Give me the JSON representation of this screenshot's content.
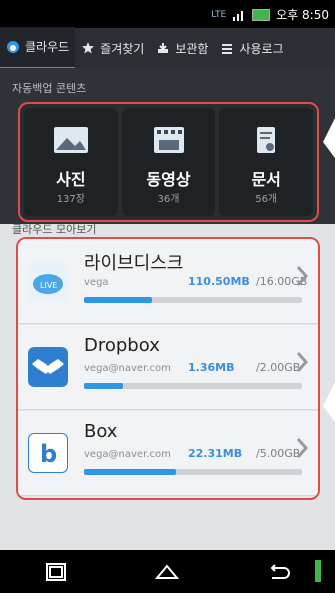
{
  "status": {
    "time": "오후 8:50",
    "network": "LTE"
  },
  "tabs": [
    {
      "label": "클라우드"
    },
    {
      "label": "즐겨찾기"
    },
    {
      "label": "보관함"
    },
    {
      "label": "사용로그"
    }
  ],
  "auto_backup": {
    "title": "자동백업 콘텐츠",
    "tiles": [
      {
        "label": "사진",
        "count": "137장"
      },
      {
        "label": "동영상",
        "count": "36개"
      },
      {
        "label": "문서",
        "count": "56개"
      }
    ]
  },
  "cloud_view": {
    "title": "클라우드 모아보기",
    "services": [
      {
        "name": "라이브디스크",
        "account": "vega",
        "used": "110.50MB",
        "total": "/16.00GB",
        "progress": 0.31
      },
      {
        "name": "Dropbox",
        "account": "vega@naver.com",
        "used": "1.36MB",
        "total": "/2.00GB",
        "progress": 0.18
      },
      {
        "name": "Box",
        "account": "vega@naver.com",
        "used": "22.31MB",
        "total": "/5.00GB",
        "progress": 0.42
      }
    ]
  },
  "colors": {
    "accent": "#2f97e3",
    "highlight": "#e34b4b"
  }
}
